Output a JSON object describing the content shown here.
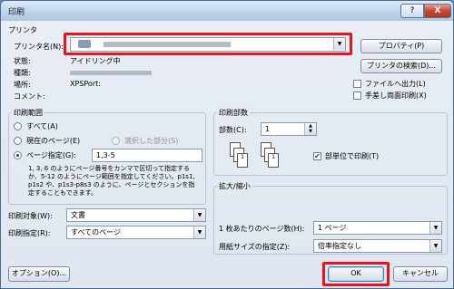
{
  "window": {
    "title": "印刷",
    "help_label": "?",
    "close_label": "X"
  },
  "printer": {
    "group_label": "プリンタ",
    "name_label": "プリンタ名(N):",
    "name_value": "(blurred printer name)",
    "properties_button": "プロパティ(P)",
    "find_button": "プリンタの検索(D)...",
    "status_label": "状態:",
    "status_value": "アイドリング中",
    "type_label": "種類:",
    "type_value": "(blurred)",
    "location_label": "場所:",
    "location_value": "XPSPort:",
    "comment_label": "コメント:",
    "print_to_file_label": "ファイルへ出力(L)",
    "manual_duplex_label": "手差し両面印刷(X)"
  },
  "range": {
    "group_label": "印刷範囲",
    "all_label": "すべて(A)",
    "current_page_label": "現在のページ(E)",
    "selection_label": "選択した部分(S)",
    "pages_label": "ページ指定(G):",
    "pages_value": "1,3-5",
    "help_text": "1, 3, 6 のようにページ番号をカンマで区切って指定するか、5-12 のようにページ範囲を指定してください。p1s1, p1s2 や、p1s3-p8s3 のように、ページとセクションを指定することもできます。"
  },
  "copies": {
    "group_label": "印刷部数",
    "count_label": "部数(C):",
    "count_value": "1",
    "collate_label": "部単位で印刷(T)"
  },
  "options": {
    "print_what_label": "印刷対象(W):",
    "print_what_value": "文書",
    "print_label": "印刷指定(R):",
    "print_value": "すべてのページ"
  },
  "zoom": {
    "group_label": "拡大/縮小",
    "pages_per_sheet_label": "1 枚あたりのページ数(H):",
    "pages_per_sheet_value": "1 ページ",
    "scale_to_paper_label": "用紙サイズの指定(Z):",
    "scale_to_paper_value": "倍率指定なし"
  },
  "footer": {
    "options_button": "オプション(O)...",
    "ok_button": "OK",
    "cancel_button": "キャンセル"
  },
  "colors": {
    "highlight": "#e8141e"
  }
}
